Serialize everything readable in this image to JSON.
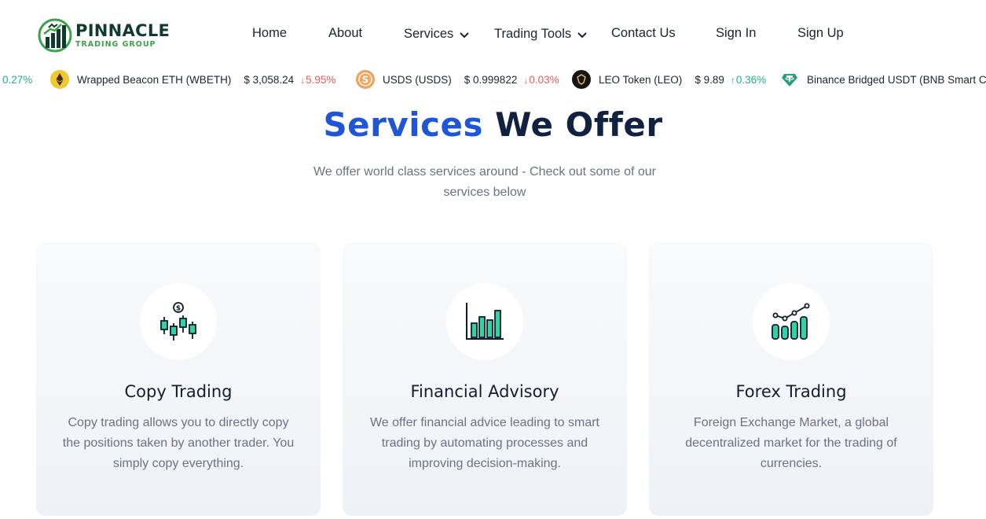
{
  "brand": {
    "title": "PINNACLE",
    "subtitle": "TRADING GROUP",
    "logo_icon": "chart-bars-bull-logo-icon",
    "colors": {
      "primary": "#0f3b2e",
      "accent": "#3aa24a"
    }
  },
  "nav": {
    "items": [
      {
        "label": "Home",
        "has_dropdown": false
      },
      {
        "label": "About",
        "has_dropdown": false
      },
      {
        "label": "Services",
        "has_dropdown": true
      },
      {
        "label": "Trading Tools",
        "has_dropdown": true
      },
      {
        "label": "Contact Us",
        "has_dropdown": false
      },
      {
        "label": "Sign In",
        "has_dropdown": false
      },
      {
        "label": "Sign Up",
        "has_dropdown": false
      }
    ]
  },
  "ticker": {
    "items": [
      {
        "name": "",
        "price": "",
        "change": "0.27%",
        "direction": "up",
        "icon": "none"
      },
      {
        "name": "Wrapped Beacon ETH (WBETH)",
        "price": "$ 3,058.24",
        "change": "5.95%",
        "direction": "down",
        "icon": "ethereum-coin-icon"
      },
      {
        "name": "USDS (USDS)",
        "price": "$ 0.999822",
        "change": "0.03%",
        "direction": "down",
        "icon": "usds-coin-icon"
      },
      {
        "name": "LEO Token (LEO)",
        "price": "$ 9.89",
        "change": "0.36%",
        "direction": "up",
        "icon": "leo-coin-icon"
      },
      {
        "name": "Binance Bridged USDT (BNB Smart C",
        "price": "",
        "change": "",
        "direction": "",
        "icon": "tether-coin-icon"
      }
    ],
    "colors": {
      "up": "#21b37a",
      "down": "#ea5a5a"
    }
  },
  "section": {
    "title_highlight": "Services",
    "title_rest": "We Offer",
    "subtitle": "We offer world class services around - Check out some of our services below",
    "colors": {
      "highlight": "#1f56d8",
      "dark": "#0f2340"
    }
  },
  "cards": [
    {
      "title": "Copy Trading",
      "text": "Copy trading allows you to directly copy the positions taken by another trader. You simply copy everything.",
      "icon": "candlestick-dollar-icon"
    },
    {
      "title": "Financial Advisory",
      "text": "We offer financial advice leading to smart trading by automating processes and improving decision-making.",
      "icon": "bar-chart-icon"
    },
    {
      "title": "Forex Trading",
      "text": "Foreign Exchange Market, a global decentralized market for the trading of currencies.",
      "icon": "trend-bar-chart-icon"
    }
  ],
  "icon_color": "#2fd3a8"
}
